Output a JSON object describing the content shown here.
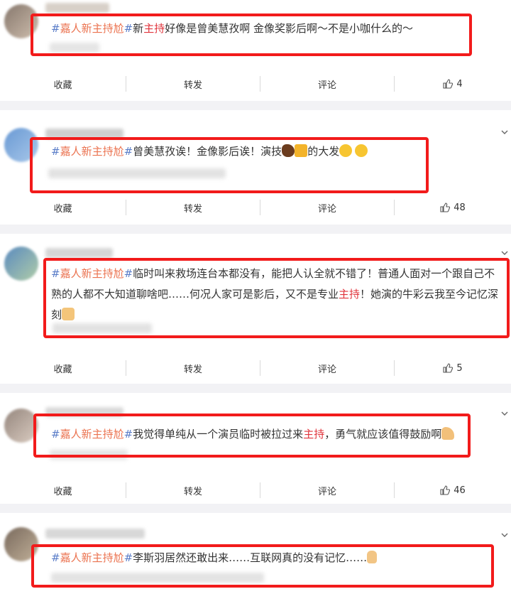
{
  "posts": [
    {
      "hashtag": "嘉人新主持尬",
      "parts": [
        "新",
        "主持",
        "好像是曾美慧孜啊 金像奖影后啊～不是小咖什么的～"
      ],
      "actions": {
        "favorite": "收藏",
        "repost": "转发",
        "comment": "评论",
        "likes": "4"
      }
    },
    {
      "hashtag": "嘉人新主持尬",
      "parts": [
        "曾美慧孜诶！金像影后诶！演技"
      ],
      "emoji_after_text": [
        "horse-face",
        "beer-mug"
      ],
      "tail": "的大发",
      "emoji_tail": [
        "screaming-face",
        "screaming-face"
      ],
      "actions": {
        "favorite": "收藏",
        "repost": "转发",
        "comment": "评论",
        "likes": "48"
      }
    },
    {
      "hashtag": "嘉人新主持尬",
      "line1": "临时叫来救场连台本都没有，能把人认全就不错了！普通人面对一个跟自己不",
      "line2a": "熟的人都不大知道聊啥吧……何况人家可是影后，又不是专业",
      "line2kw": "主持",
      "line2b": "！她演的牛彩云我至今记忆深",
      "line3": "刻",
      "emoji": "thumbs-up",
      "actions": {
        "favorite": "收藏",
        "repost": "转发",
        "comment": "评论",
        "likes": "5"
      }
    },
    {
      "hashtag": "嘉人新主持尬",
      "partA": "我觉得单纯从一个演员临时被拉过来",
      "kw": "主持",
      "partB": "，勇气就应该值得鼓励啊",
      "emoji": "flexed-biceps",
      "actions": {
        "favorite": "收藏",
        "repost": "转发",
        "comment": "评论",
        "likes": "46"
      }
    },
    {
      "hashtag": "嘉人新主持尬",
      "text": "李斯羽居然还敢出来……互联网真的没有记忆……",
      "emoji": "index-pointing-up"
    }
  ],
  "colors": {
    "hashtag": "#eb7350",
    "hash_symbol": "#5a7dc8",
    "keyword": "#e0333b",
    "highlight_box": "#f21b1b"
  }
}
